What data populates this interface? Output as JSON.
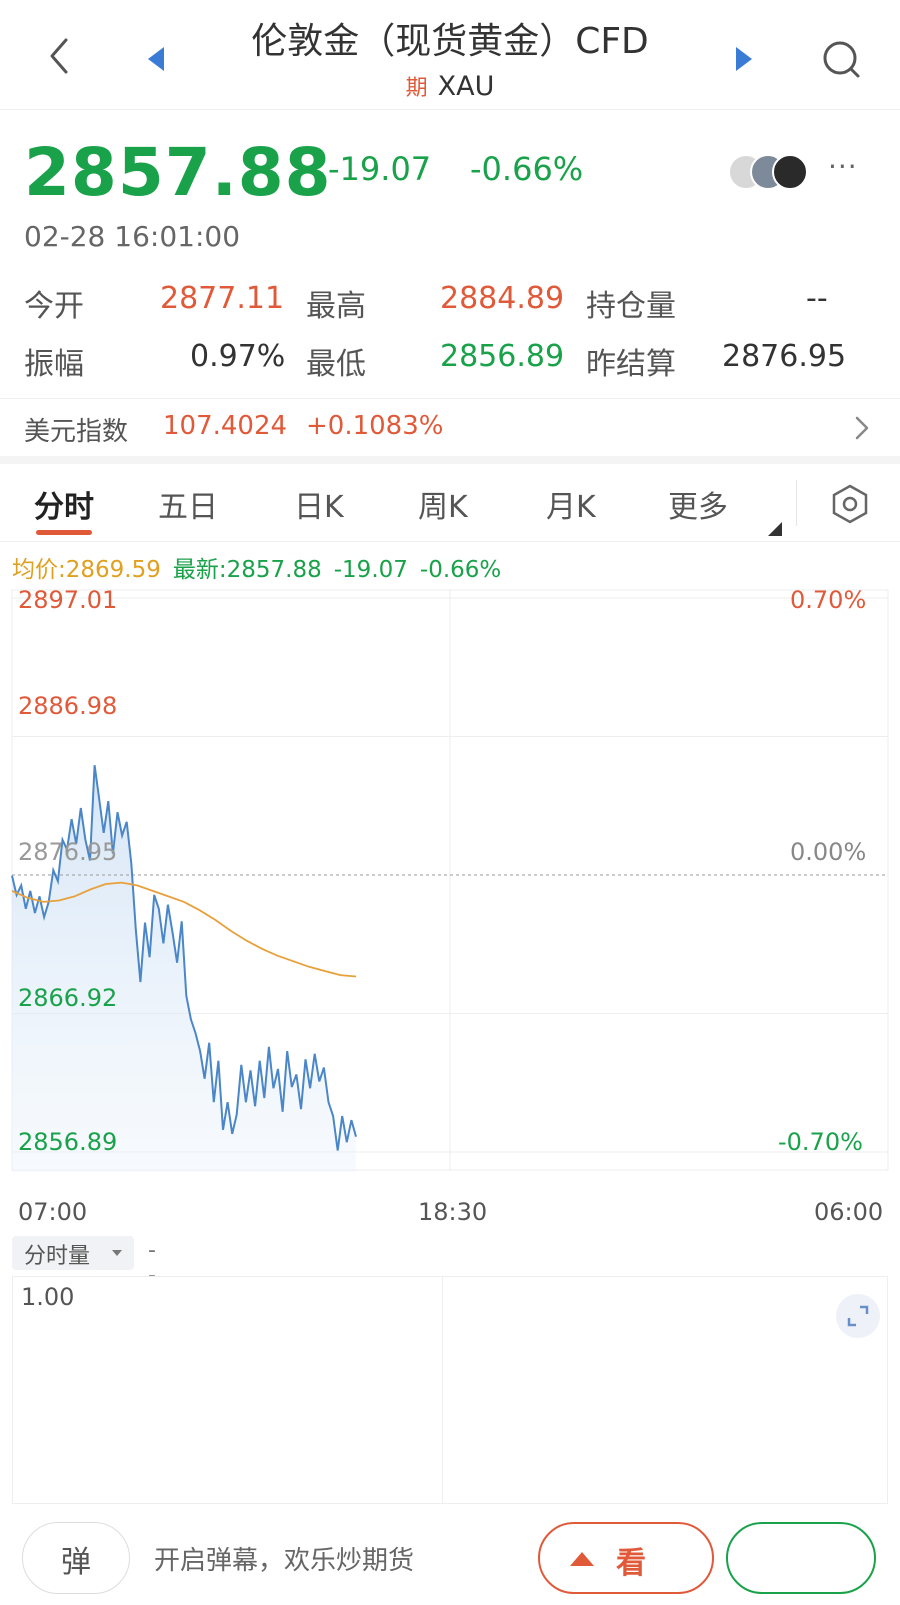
{
  "header": {
    "title": "伦敦金（现货黄金）CFD",
    "tag": "期",
    "symbol": "XAU"
  },
  "quote": {
    "last": "2857.88",
    "change": "-19.07",
    "change_pct": "-0.66%",
    "timestamp": "02-28 16:01:00",
    "more": "···"
  },
  "stats": {
    "open_label": "今开",
    "open": "2877.11",
    "high_label": "最高",
    "high": "2884.89",
    "oi_label": "持仓量",
    "oi": "--",
    "amp_label": "振幅",
    "amp": "0.97%",
    "low_label": "最低",
    "low": "2856.89",
    "prev_label": "昨结算",
    "prev": "2876.95"
  },
  "dollar_index": {
    "label": "美元指数",
    "value": "107.4024",
    "change": "+0.1083%"
  },
  "tabs": [
    "分时",
    "五日",
    "日K",
    "周K",
    "月K",
    "更多"
  ],
  "legend": {
    "avg": "均价:2869.59",
    "latest": "最新:2857.88",
    "change": "-19.07",
    "pct": "-0.66%"
  },
  "colors": {
    "up": "#e05a3a",
    "down": "#19a24a",
    "price_line": "#4a86c8",
    "avg_line": "#e8a03a"
  },
  "chart_data": {
    "type": "line",
    "y_ticks": [
      "2897.01",
      "2886.98",
      "2876.95",
      "2866.92",
      "2856.89"
    ],
    "pct_ticks": [
      "0.70%",
      "0.00%",
      "-0.70%"
    ],
    "x_ticks": [
      "07:00",
      "18:30",
      "06:00"
    ],
    "ylim": [
      2856.89,
      2897.01
    ],
    "baseline": 2876.95,
    "series": [
      {
        "values": [
          2876.9,
          2875.5,
          2876.2,
          2874.5,
          2875.8,
          2874.2,
          2875.4,
          2873.9,
          2875.0,
          2877.3,
          2876.5,
          2879.5,
          2878.8,
          2881.0,
          2879.2,
          2881.8,
          2879.5,
          2878.0,
          2884.9,
          2882.5,
          2880.0,
          2882.3,
          2878.5,
          2881.5,
          2879.8,
          2880.8,
          2877.8,
          2873.0,
          2869.2,
          2873.5,
          2871.0,
          2875.5,
          2874.5,
          2872.0,
          2874.8,
          2872.8,
          2870.6,
          2873.6,
          2868.2,
          2866.5,
          2865.5,
          2864.2,
          2862.2,
          2864.8,
          2860.5,
          2863.5,
          2858.5,
          2860.5,
          2858.2,
          2859.6,
          2863.2,
          2860.5,
          2862.8,
          2860.2,
          2863.5,
          2860.8,
          2864.5,
          2861.5,
          2862.9,
          2859.8,
          2864.2,
          2861.6,
          2862.5,
          2860.0,
          2863.6,
          2861.5,
          2864.0,
          2862.0,
          2863.0,
          2860.5,
          2859.5,
          2857.0,
          2859.5,
          2857.6,
          2859.2,
          2858.0
        ]
      },
      {
        "values": [
          2875.8,
          2875.3,
          2875.0,
          2875.1,
          2875.4,
          2875.9,
          2876.3,
          2876.4,
          2876.2,
          2875.8,
          2875.4,
          2875.0,
          2874.4,
          2873.7,
          2872.9,
          2872.2,
          2871.6,
          2871.1,
          2870.7,
          2870.3,
          2870.0,
          2869.7,
          2869.6
        ]
      }
    ]
  },
  "volume": {
    "selector": "分时量",
    "value": "--",
    "scale": "1.00"
  },
  "bottom": {
    "danmu_btn": "弹",
    "hint": "开启弹幕，欢乐炒期货",
    "look": "看"
  }
}
